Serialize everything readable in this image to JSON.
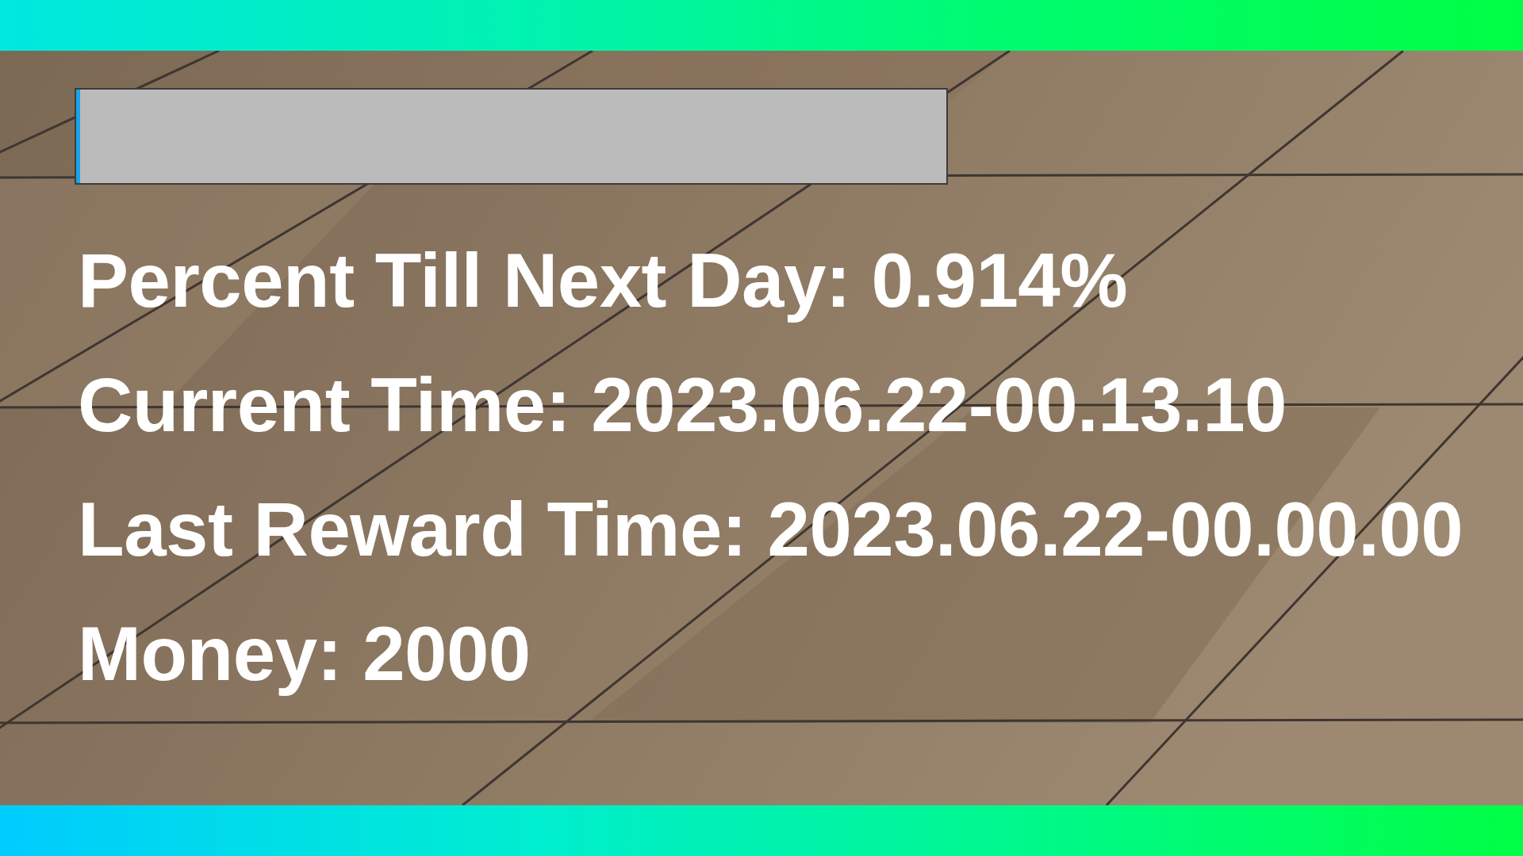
{
  "day_progress": {
    "level": 0.005
  },
  "info_lines": [
    "Percent Till Next Day: 0.914%",
    "Current Time: 2023.06.22-00.13.10",
    "Last Reward Time: 2023.06.22-00.00.00",
    "Money: 2000"
  ]
}
